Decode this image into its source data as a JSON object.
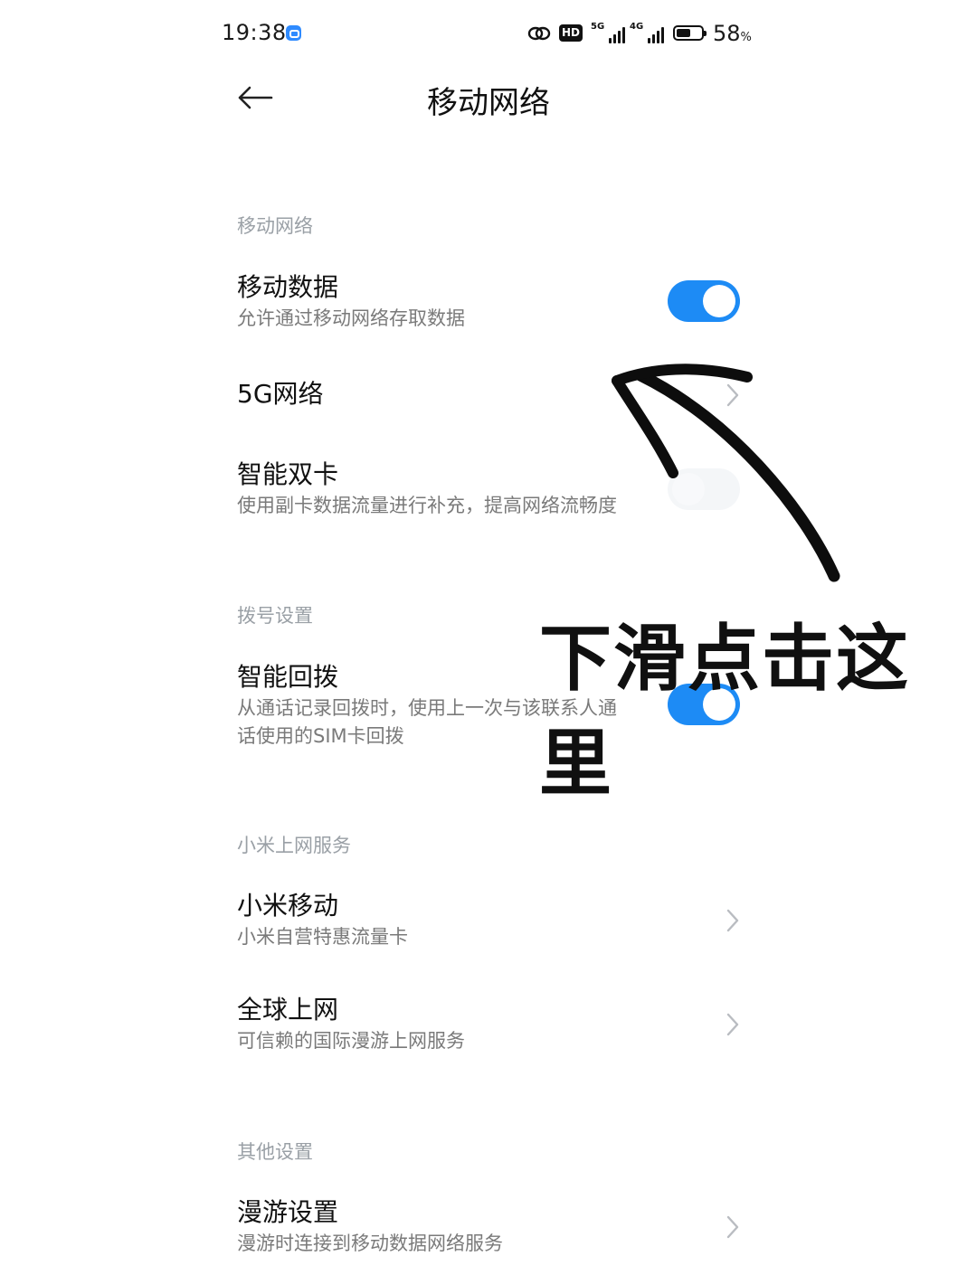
{
  "status_bar": {
    "time": "19:38",
    "hd_label": "HD",
    "signal_1_label": "5G",
    "signal_2_label": "4G",
    "battery_percent": "58",
    "battery_unit": "%",
    "battery_level": 0.58,
    "icons": [
      "app-notification-icon",
      "link-icon",
      "hd-voice-icon",
      "signal-5g-icon",
      "signal-4g-icon",
      "battery-icon"
    ]
  },
  "header": {
    "title": "移动网络",
    "back_icon": "arrow-left-icon"
  },
  "sections": {
    "mobile_network": {
      "label": "移动网络",
      "mobile_data": {
        "title": "移动数据",
        "subtitle": "允许通过移动网络存取数据",
        "enabled": true
      },
      "five_g": {
        "title": "5G网络"
      },
      "smart_dual_sim": {
        "title": "智能双卡",
        "subtitle": "使用副卡数据流量进行补充，提高网络流畅度",
        "enabled": false
      }
    },
    "dial_settings": {
      "label": "拨号设置",
      "smart_redial": {
        "title": "智能回拨",
        "subtitle_line1": "从通话记录回拨时，使用上一次与该联系人通",
        "subtitle_line2": "话使用的SIM卡回拨",
        "enabled": true
      }
    },
    "mi_services": {
      "label": "小米上网服务",
      "mi_mobile": {
        "title": "小米移动",
        "subtitle": "小米自营特惠流量卡"
      },
      "global_internet": {
        "title": "全球上网",
        "subtitle": "可信赖的国际漫游上网服务"
      }
    },
    "other_settings": {
      "label": "其他设置",
      "roaming": {
        "title": "漫游设置",
        "subtitle": "漫游时连接到移动数据网络服务"
      }
    }
  },
  "annotation": {
    "text": "下滑点击这里"
  },
  "colors": {
    "accent": "#1d8bf5",
    "section_label": "#9aa0a6",
    "subtitle": "#7a7a7a"
  }
}
